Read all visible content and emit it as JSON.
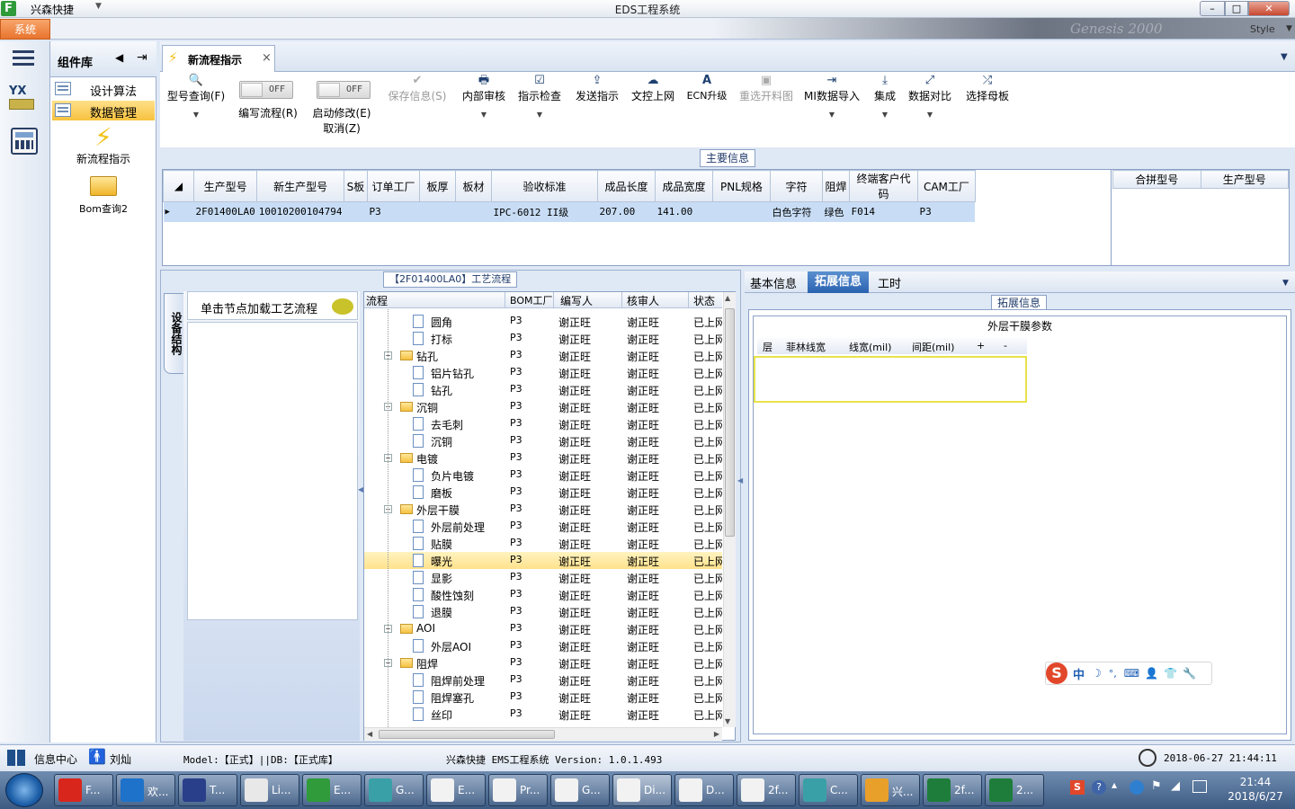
{
  "titlebar": {
    "app_name": "兴森快捷",
    "title": "EDS工程系统",
    "min": "–",
    "max": "□",
    "close": "✕"
  },
  "ribbon": {
    "system_tab": "系统",
    "style_label": "Style",
    "brand_watermark": "Genesis 2000"
  },
  "component_panel": {
    "title": "组件库",
    "items": [
      {
        "label": "设计算法"
      },
      {
        "label": "数据管理"
      }
    ],
    "launchers": [
      {
        "label": "新流程指示"
      },
      {
        "label": "Bom查询2"
      }
    ]
  },
  "doc_tab": {
    "label": "新流程指示",
    "close": "×"
  },
  "toolbar": {
    "buttons": [
      {
        "label": "型号查询(F)",
        "icon": "🔍",
        "dd": "▼"
      },
      {
        "label": "编写流程(R)",
        "toggle": "OFF"
      },
      {
        "label": "启动修改(E)",
        "label2": "取消(Z)",
        "toggle": "OFF"
      },
      {
        "label": "保存信息(S)",
        "icon": "✔"
      },
      {
        "label": "内部审核",
        "icon": "🖶",
        "dd": "▼"
      },
      {
        "label": "指示检查",
        "icon": "☑",
        "dd": "▼"
      },
      {
        "label": "发送指示",
        "icon": "⇪"
      },
      {
        "label": "文控上网",
        "icon": "☁"
      },
      {
        "label": "ECN升级",
        "icon": "A"
      },
      {
        "label": "重选开料图",
        "icon": "▣"
      },
      {
        "label": "MI数据导入",
        "icon": "⇥",
        "dd": "▼"
      },
      {
        "label": "集成",
        "icon": "⤓",
        "dd": "▼"
      },
      {
        "label": "数据对比",
        "icon": "⤢",
        "dd": "▼"
      },
      {
        "label": "选择母板",
        "icon": "⤮"
      }
    ]
  },
  "main_info": {
    "caption": "主要信息",
    "headers": [
      "生产型号",
      "新生产型号",
      "S板",
      "订单工厂",
      "板厚",
      "板材",
      "验收标准",
      "成品长度",
      "成品宽度",
      "PNL规格",
      "字符",
      "阻焊",
      "终端客户代码",
      "CAM工厂"
    ],
    "row": [
      "2F01400LA0",
      "10010200104794",
      "",
      "P3",
      "",
      "",
      "IPC-6012 II级",
      "207.00",
      "141.00",
      "",
      "白色字符",
      "绿色",
      "F014",
      "P3"
    ],
    "side_headers": [
      "合拼型号",
      "生产型号"
    ]
  },
  "process": {
    "caption": "【2F01400LA0】工艺流程",
    "vertical_tab": "设备结构",
    "node_header": "单击节点加载工艺流程",
    "columns": [
      "流程",
      "BOM工厂",
      "编写人",
      "核审人",
      "状态"
    ],
    "rows": [
      {
        "name": "圆角",
        "level": 2,
        "type": "doc",
        "bom": "P3",
        "writer": "谢正旺",
        "reviewer": "谢正旺",
        "status": "已上网"
      },
      {
        "name": "打标",
        "level": 2,
        "type": "doc",
        "bom": "P3",
        "writer": "谢正旺",
        "reviewer": "谢正旺",
        "status": "已上网"
      },
      {
        "name": "钻孔",
        "level": 1,
        "type": "folder",
        "bom": "P3",
        "writer": "谢正旺",
        "reviewer": "谢正旺",
        "status": "已上网"
      },
      {
        "name": "铝片钻孔",
        "level": 2,
        "type": "doc",
        "bom": "P3",
        "writer": "谢正旺",
        "reviewer": "谢正旺",
        "status": "已上网"
      },
      {
        "name": "钻孔",
        "level": 2,
        "type": "doc",
        "bom": "P3",
        "writer": "谢正旺",
        "reviewer": "谢正旺",
        "status": "已上网"
      },
      {
        "name": "沉铜",
        "level": 1,
        "type": "folder",
        "bom": "P3",
        "writer": "谢正旺",
        "reviewer": "谢正旺",
        "status": "已上网"
      },
      {
        "name": "去毛刺",
        "level": 2,
        "type": "doc",
        "bom": "P3",
        "writer": "谢正旺",
        "reviewer": "谢正旺",
        "status": "已上网"
      },
      {
        "name": "沉铜",
        "level": 2,
        "type": "doc",
        "bom": "P3",
        "writer": "谢正旺",
        "reviewer": "谢正旺",
        "status": "已上网"
      },
      {
        "name": "电镀",
        "level": 1,
        "type": "folder",
        "bom": "P3",
        "writer": "谢正旺",
        "reviewer": "谢正旺",
        "status": "已上网"
      },
      {
        "name": "负片电镀",
        "level": 2,
        "type": "doc",
        "bom": "P3",
        "writer": "谢正旺",
        "reviewer": "谢正旺",
        "status": "已上网"
      },
      {
        "name": "磨板",
        "level": 2,
        "type": "doc",
        "bom": "P3",
        "writer": "谢正旺",
        "reviewer": "谢正旺",
        "status": "已上网"
      },
      {
        "name": "外层干膜",
        "level": 1,
        "type": "folder",
        "bom": "P3",
        "writer": "谢正旺",
        "reviewer": "谢正旺",
        "status": "已上网"
      },
      {
        "name": "外层前处理",
        "level": 2,
        "type": "doc",
        "bom": "P3",
        "writer": "谢正旺",
        "reviewer": "谢正旺",
        "status": "已上网"
      },
      {
        "name": "贴膜",
        "level": 2,
        "type": "doc",
        "bom": "P3",
        "writer": "谢正旺",
        "reviewer": "谢正旺",
        "status": "已上网"
      },
      {
        "name": "曝光",
        "level": 2,
        "type": "doc",
        "bom": "P3",
        "writer": "谢正旺",
        "reviewer": "谢正旺",
        "status": "已上网",
        "selected": true
      },
      {
        "name": "显影",
        "level": 2,
        "type": "doc",
        "bom": "P3",
        "writer": "谢正旺",
        "reviewer": "谢正旺",
        "status": "已上网"
      },
      {
        "name": "酸性蚀刻",
        "level": 2,
        "type": "doc",
        "bom": "P3",
        "writer": "谢正旺",
        "reviewer": "谢正旺",
        "status": "已上网"
      },
      {
        "name": "退膜",
        "level": 2,
        "type": "doc",
        "bom": "P3",
        "writer": "谢正旺",
        "reviewer": "谢正旺",
        "status": "已上网"
      },
      {
        "name": "AOI",
        "level": 1,
        "type": "folder",
        "bom": "P3",
        "writer": "谢正旺",
        "reviewer": "谢正旺",
        "status": "已上网"
      },
      {
        "name": "外层AOI",
        "level": 2,
        "type": "doc",
        "bom": "P3",
        "writer": "谢正旺",
        "reviewer": "谢正旺",
        "status": "已上网"
      },
      {
        "name": "阻焊",
        "level": 1,
        "type": "folder",
        "bom": "P3",
        "writer": "谢正旺",
        "reviewer": "谢正旺",
        "status": "已上网"
      },
      {
        "name": "阻焊前处理",
        "level": 2,
        "type": "doc",
        "bom": "P3",
        "writer": "谢正旺",
        "reviewer": "谢正旺",
        "status": "已上网"
      },
      {
        "name": "阻焊塞孔",
        "level": 2,
        "type": "doc",
        "bom": "P3",
        "writer": "谢正旺",
        "reviewer": "谢正旺",
        "status": "已上网"
      },
      {
        "name": "丝印",
        "level": 2,
        "type": "doc",
        "bom": "P3",
        "writer": "谢正旺",
        "reviewer": "谢正旺",
        "status": "已上网"
      }
    ]
  },
  "right_panel": {
    "tabs": [
      "基本信息",
      "拓展信息",
      "工时"
    ],
    "group_caption": "拓展信息",
    "inner_title": "外层干膜参数",
    "columns": [
      "层",
      "菲林线宽",
      "线宽(mil)",
      "间距(mil)",
      "+",
      "-"
    ]
  },
  "ime": {
    "logo": "S",
    "lang": "中",
    "items": [
      "☽",
      "°,",
      "⌨",
      "👤",
      "👕",
      "🔧"
    ]
  },
  "statusbar": {
    "info_center": "信息中心",
    "user": "刘灿",
    "model": "Model:【正式】||DB:【正式库】",
    "version": "兴森快捷 EMS工程系统 Version: 1.0.1.493",
    "datetime": "2018-06-27 21:44:11"
  },
  "taskbar": {
    "tasks": [
      {
        "label": "F...",
        "color": "#d9261c"
      },
      {
        "label": "欢...",
        "color": "#1e72c9"
      },
      {
        "label": "T...",
        "color": "#2a3f8a"
      },
      {
        "label": "Li...",
        "color": "#e8e8e8"
      },
      {
        "label": "E...",
        "color": "#2f9b3a"
      },
      {
        "label": "G...",
        "color": "#3aa0a8"
      },
      {
        "label": "E...",
        "color": "#f2f2f2"
      },
      {
        "label": "Pr...",
        "color": "#f2f2f2"
      },
      {
        "label": "G...",
        "color": "#f2f2f2"
      },
      {
        "label": "Di...",
        "color": "#f2f2f2",
        "active": true
      },
      {
        "label": "D...",
        "color": "#f2f2f2"
      },
      {
        "label": "2f...",
        "color": "#f2f2f2"
      },
      {
        "label": "C...",
        "color": "#3aa0a8"
      },
      {
        "label": "兴...",
        "color": "#e8a02a"
      },
      {
        "label": "2f...",
        "color": "#1e7d3a"
      },
      {
        "label": "2...",
        "color": "#1e7d3a"
      }
    ],
    "time": "21:44",
    "date": "2018/6/27"
  }
}
